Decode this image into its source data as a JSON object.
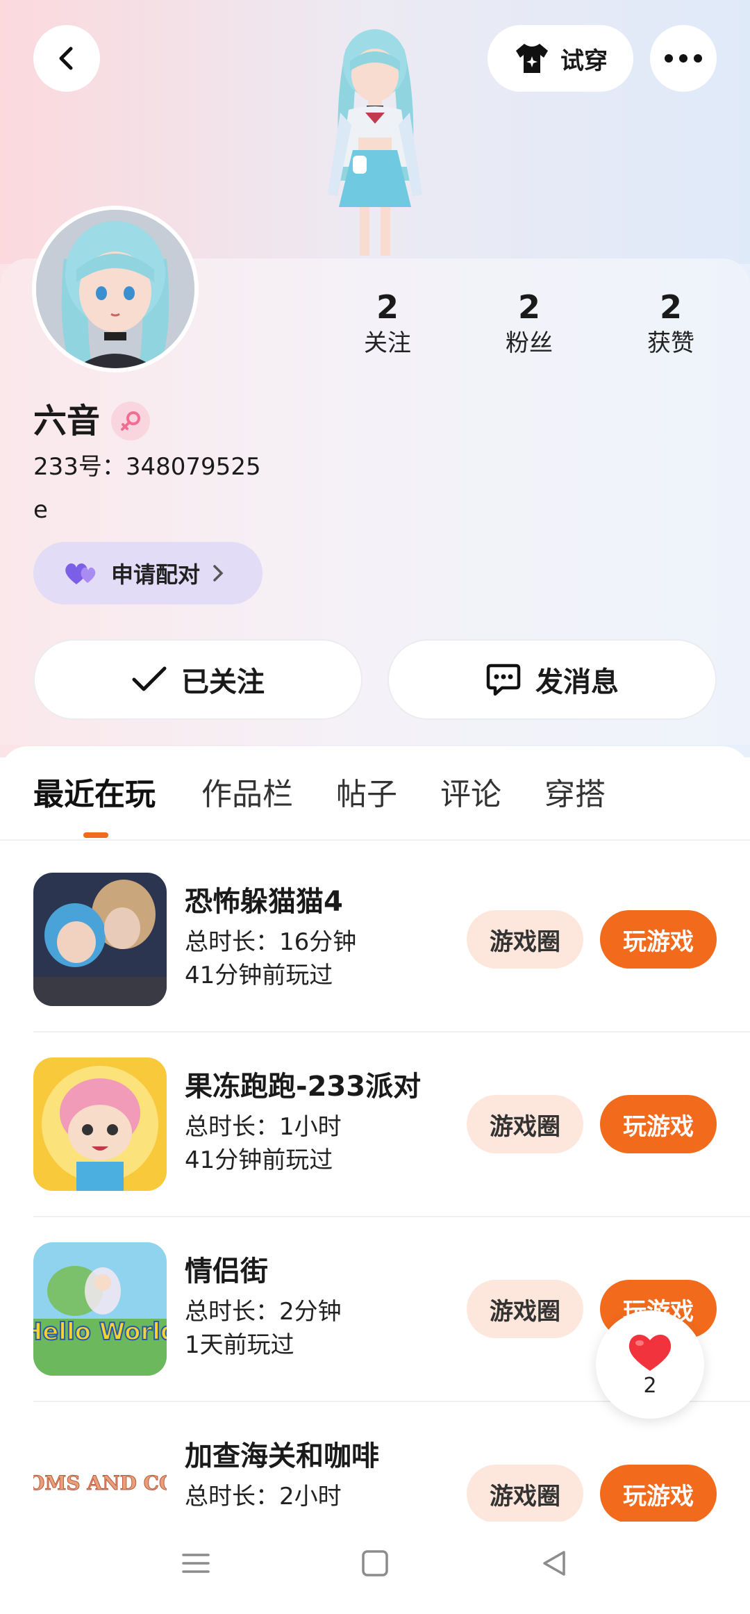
{
  "header": {
    "try_on_label": "试穿"
  },
  "profile": {
    "name": "六音",
    "uid": "233号：348079525",
    "bio": "e",
    "pair_label": "申请配对",
    "stats": [
      {
        "value": "2",
        "label": "关注"
      },
      {
        "value": "2",
        "label": "粉丝"
      },
      {
        "value": "2",
        "label": "获赞"
      }
    ],
    "follow_label": "已关注",
    "message_label": "发消息"
  },
  "tabs": [
    {
      "label": "最近在玩"
    },
    {
      "label": "作品栏"
    },
    {
      "label": "帖子"
    },
    {
      "label": "评论"
    },
    {
      "label": "穿搭"
    }
  ],
  "games": [
    {
      "title": "恐怖躲猫猫4",
      "duration": "总时长：16分钟",
      "last_played": "41分钟前玩过",
      "circle_label": "游戏圈",
      "play_label": "玩游戏"
    },
    {
      "title": "果冻跑跑-233派对",
      "duration": "总时长：1小时",
      "last_played": "41分钟前玩过",
      "circle_label": "游戏圈",
      "play_label": "玩游戏"
    },
    {
      "title": "情侣街",
      "duration": "总时长：2分钟",
      "last_played": "1天前玩过",
      "circle_label": "游戏圈",
      "play_label": "玩游戏"
    },
    {
      "title": "加查海关和咖啡",
      "duration": "总时长：2小时",
      "last_played": "",
      "circle_label": "游戏圈",
      "play_label": "玩游戏"
    }
  ],
  "game_art_text": {
    "game3": "Hello World",
    "game4": "CUSTOMS AND COFFEE"
  },
  "like_float": {
    "count": "2"
  },
  "colors": {
    "accent": "#f26b1d",
    "pill_light": "#fde7dc",
    "pair_bg": "#e2dcf7"
  }
}
